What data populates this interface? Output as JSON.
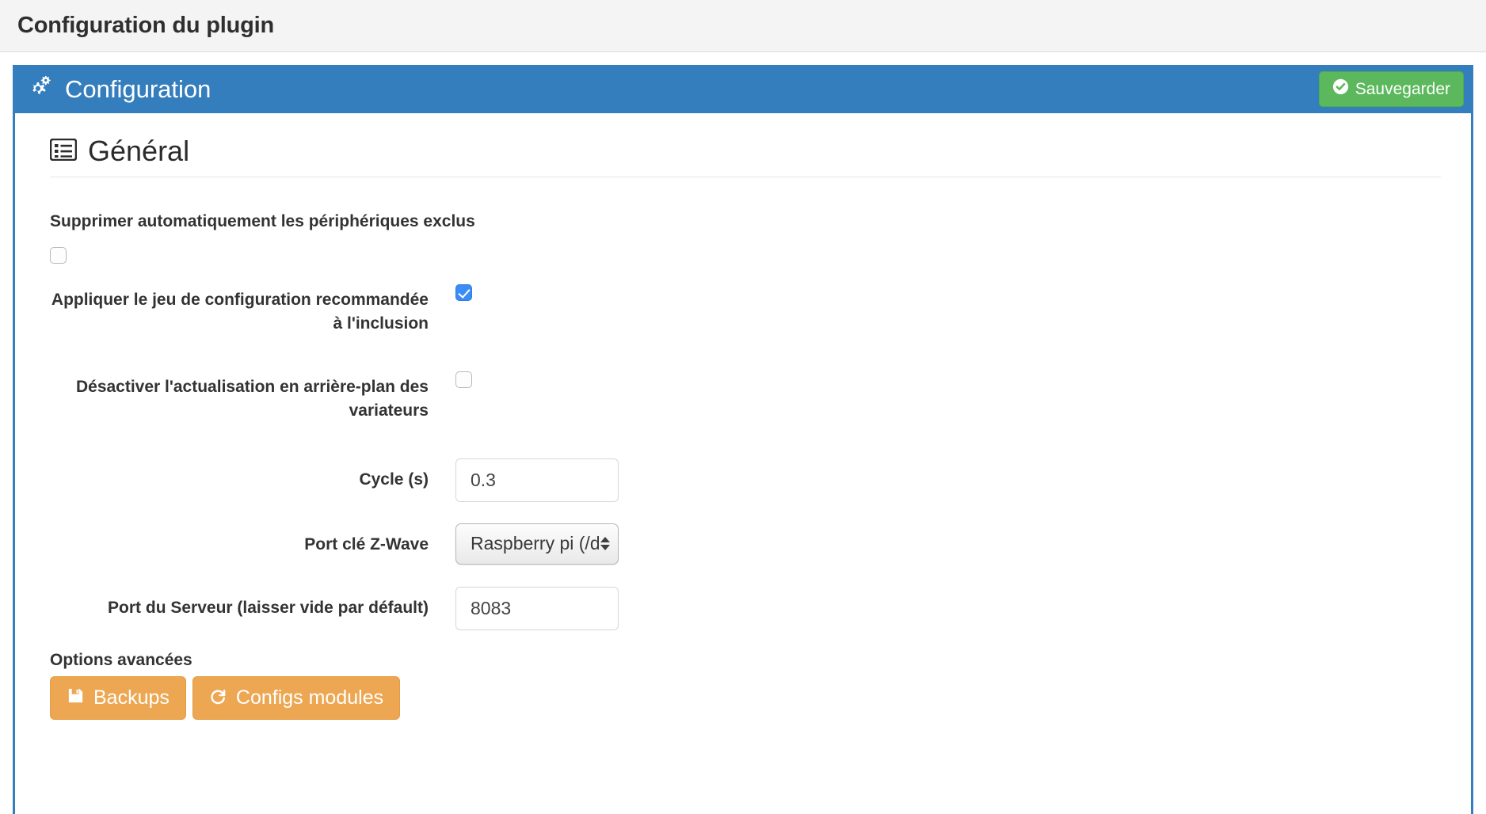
{
  "page": {
    "title": "Configuration du plugin",
    "background_color": "#f4f4f4"
  },
  "panel": {
    "accent_color": "#357ebd",
    "header": {
      "icon": "cogs-icon",
      "title": "Configuration",
      "save_button": {
        "label": "Sauvegarder",
        "icon": "check-circle-icon",
        "color": "#5cb85c"
      }
    },
    "section": {
      "icon": "list-alt-icon",
      "title": "Général"
    },
    "form": {
      "auto_delete": {
        "label": "Supprimer automatiquement les périphériques exclus",
        "checked": false
      },
      "rows": [
        {
          "label": "Appliquer le jeu de configuration recommandée à l'inclusion",
          "type": "checkbox",
          "checked": true
        },
        {
          "label": "Désactiver l'actualisation en arrière-plan des variateurs",
          "type": "checkbox",
          "checked": false
        },
        {
          "label": "Cycle (s)",
          "type": "text",
          "value": "0.3",
          "placeholder": ""
        },
        {
          "label": "Port clé Z-Wave",
          "type": "select",
          "value": "Raspberry pi (/d"
        },
        {
          "label": "Port du Serveur (laisser vide par défault)",
          "type": "text",
          "value": "8083",
          "placeholder": ""
        }
      ]
    },
    "advanced": {
      "title": "Options avancées",
      "accent_color": "#eda752",
      "buttons": [
        {
          "label": "Backups",
          "icon": "save-floppy-icon"
        },
        {
          "label": "Configs modules",
          "icon": "refresh-icon"
        }
      ]
    }
  }
}
